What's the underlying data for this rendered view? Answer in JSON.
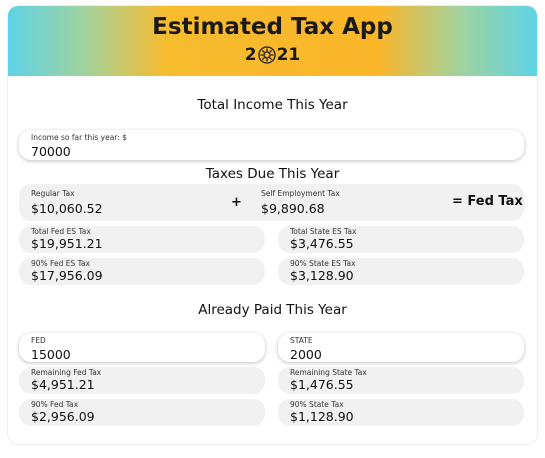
{
  "header": {
    "title": "Estimated Tax App",
    "year_prefix": "2",
    "year_suffix": "21",
    "icon": "sun-icon",
    "gradient_colors": [
      "#5fd3e6",
      "#fbb62a"
    ]
  },
  "income": {
    "section_title": "Total Income This Year",
    "label": "Income so far this year: $",
    "value": "70000"
  },
  "taxes_due": {
    "section_title": "Taxes Due This Year",
    "regular_tax_label": "Regular Tax",
    "regular_tax_value": "$10,060.52",
    "plus_sign": "+",
    "se_tax_label": "Self Employment Tax",
    "se_tax_value": "$9,890.68",
    "equals_label": "= Fed Tax",
    "total_fed_label": "Total Fed ES Tax",
    "total_fed_value": "$19,951.21",
    "total_state_label": "Total State ES Tax",
    "total_state_value": "$3,476.55",
    "fed90_label": "90% Fed ES Tax",
    "fed90_value": "$17,956.09",
    "state90_label": "90% State ES Tax",
    "state90_value": "$3,128.90"
  },
  "paid": {
    "section_title": "Already Paid This Year",
    "fed_label": "FED",
    "fed_value": "15000",
    "state_label": "STATE",
    "state_value": "2000",
    "rem_fed_label": "Remaining Fed Tax",
    "rem_fed_value": "$4,951.21",
    "rem_state_label": "Remaining State Tax",
    "rem_state_value": "$1,476.55",
    "fed90_label": "90% Fed Tax",
    "fed90_value": "$2,956.09",
    "state90_label": "90% State Tax",
    "state90_value": "$1,128.90"
  }
}
